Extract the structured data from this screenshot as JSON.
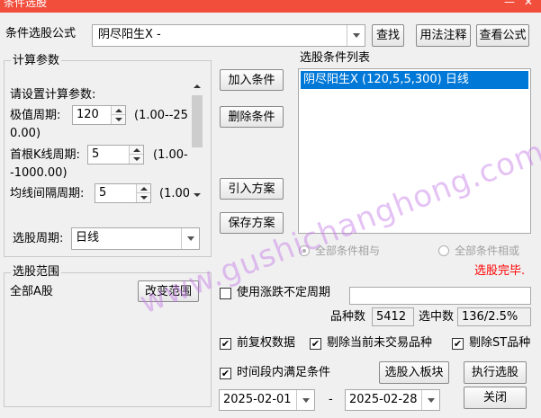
{
  "window": {
    "title": "条件选股",
    "minimize": "—",
    "close": "✕"
  },
  "formula": {
    "label": "条件选股公式",
    "value": "阴尽阳生X  -",
    "find_btn": "查找",
    "usage_btn": "用法注释",
    "view_btn": "查看公式"
  },
  "params": {
    "group_title": "计算参数",
    "prompt": "请设置计算参数:",
    "rows": [
      {
        "label": "极值周期:",
        "value": "120",
        "range_a": "(1.00--25",
        "range_b": "0.00)"
      },
      {
        "label": "首根K线周期:",
        "value": "5",
        "range_a": "(1.00-",
        "range_b": "-1000.00)"
      },
      {
        "label": "均线间隔周期:",
        "value": "5",
        "range_a": "(1.00"
      }
    ],
    "period_label": "选股周期:",
    "period_value": "日线"
  },
  "actions": {
    "add": "加入条件",
    "remove": "删除条件",
    "import": "引入方案",
    "save": "保存方案"
  },
  "conditions": {
    "title": "选股条件列表",
    "items": [
      "阴尽阳生X (120,5,5,300) 日线"
    ],
    "all_and": "全部条件相与",
    "all_or": "全部条件相或",
    "status": "选股完毕.",
    "status_color": "#ff0000"
  },
  "scope": {
    "group_title": "选股范围",
    "value": "全部A股",
    "change_btn": "改变范围"
  },
  "options": {
    "variable_period": "使用涨跌不定周期",
    "count_label": "品种数",
    "count_value": "5412",
    "selected_label": "选中数",
    "selected_value": "136/2.5%",
    "adjusted": "前复权数据",
    "exclude_untraded": "剔除当前未交易品种",
    "exclude_st": "剔除ST品种",
    "time_range": "时间段内满足条件",
    "to_block_btn": "选股入板块",
    "run_btn": "执行选股",
    "date_from": "2025-02-01",
    "date_sep": "-",
    "date_to": "2025-02-28",
    "close_btn": "关闭"
  },
  "watermark": "www.gushichanghong.com",
  "colors": {
    "titlebar": "#f24e3c",
    "selection": "#0078d7",
    "watermark": "#c478e6"
  }
}
